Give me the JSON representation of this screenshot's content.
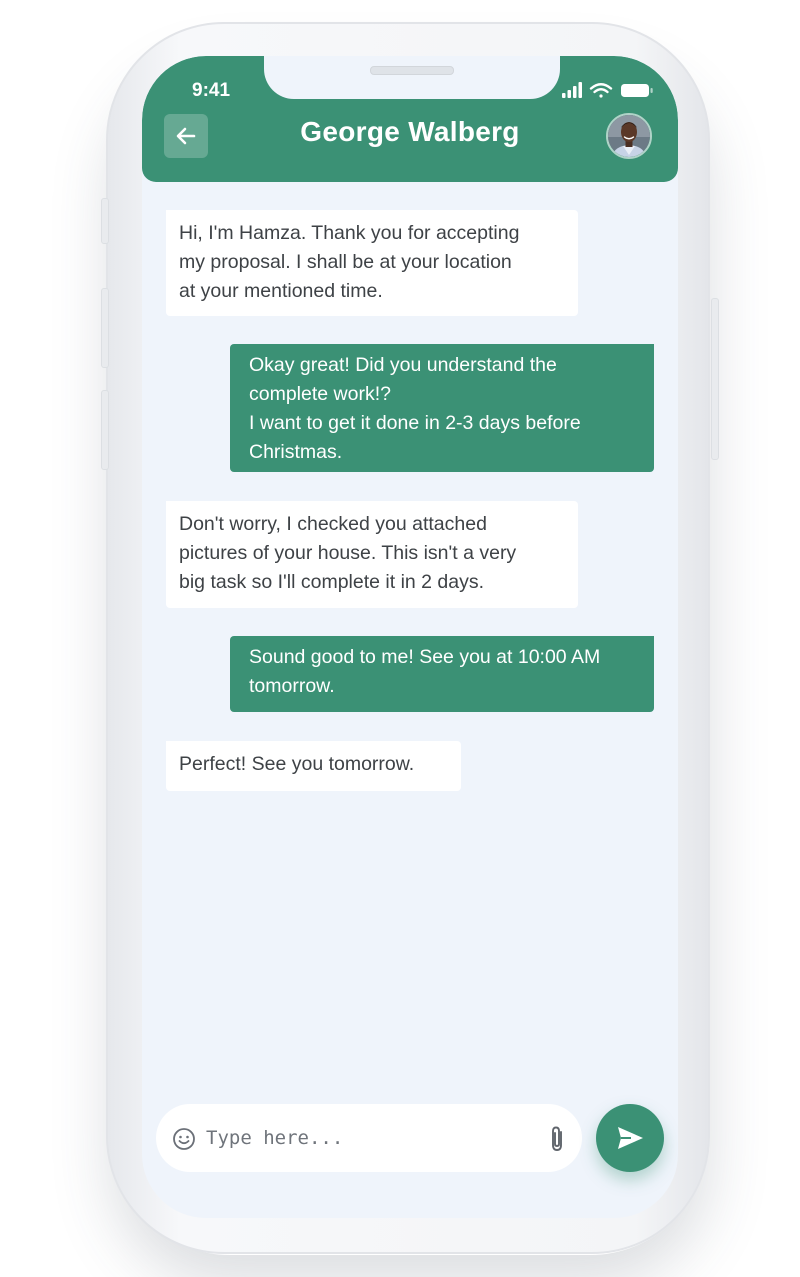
{
  "status_bar": {
    "time": "9:41"
  },
  "header": {
    "back_icon": "arrow-left-icon",
    "title": "George Walberg",
    "avatar": "contact-avatar"
  },
  "messages": [
    {
      "direction": "incoming",
      "text": "Hi, I'm Hamza. Thank you for accepting\nmy proposal. I shall be at your location\nat your mentioned time."
    },
    {
      "direction": "outgoing",
      "text": "Okay great! Did you understand the\ncomplete work!?\nI want to get it done in 2-3 days before\nChristmas."
    },
    {
      "direction": "incoming",
      "text": "Don't worry, I checked you attached\npictures of your house. This isn't a very\nbig task so I'll complete it in 2 days."
    },
    {
      "direction": "outgoing",
      "text": "Sound good to me! See you at 10:00 AM\ntomorrow."
    },
    {
      "direction": "incoming",
      "text": "Perfect! See you tomorrow."
    }
  ],
  "composer": {
    "placeholder": "Type here...",
    "emoji_icon": "smiley-icon",
    "attach_icon": "paperclip-icon",
    "send_icon": "send-icon"
  },
  "colors": {
    "accent": "#3b9175",
    "background": "#eff4fb",
    "incoming_bubble": "#ffffff",
    "incoming_text": "#3e4246",
    "outgoing_text": "#ffffff"
  }
}
